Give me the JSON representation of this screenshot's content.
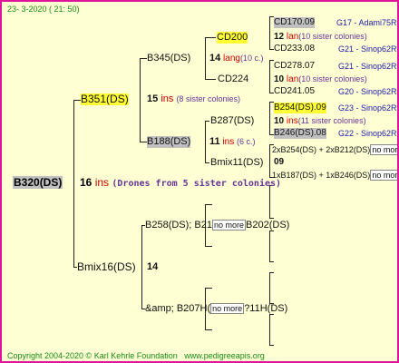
{
  "header": {
    "date": "23- 3-2020 ( 21: 50)"
  },
  "root": {
    "name": "B320(DS)"
  },
  "root_info": {
    "count": "16",
    "unit": "ins",
    "note": "(Drones from 5 sister colonies)"
  },
  "gen1": {
    "father": {
      "name": "B351(DS)",
      "count": "15",
      "unit": "ins",
      "note": "(8 sister colonies)"
    },
    "mother": {
      "name": "Bmix16(DS)",
      "count": "14"
    }
  },
  "gen2": {
    "b345": {
      "name": "B345(DS)",
      "count": "14",
      "unit": "lang",
      "note": "(10 c.)"
    },
    "b188": {
      "name": "B188(DS)",
      "count": "11",
      "unit": "ins",
      "note": "(6 c.)"
    },
    "b258": {
      "name": "B258(DS); B21",
      "nomore": "no more",
      "tail": "B202(DS)"
    },
    "b207": {
      "name": "&amp; B207H(",
      "nomore": "no more",
      "tail": "?11H(DS)"
    }
  },
  "gen3": {
    "cd200": {
      "name": "CD200"
    },
    "cd224": {
      "name": "CD224"
    },
    "b287": {
      "name": "B287(DS)"
    },
    "bmix11": {
      "name": "Bmix11(DS)"
    }
  },
  "gen4": [
    {
      "name": "CD170.09",
      "meta": "G17 - Adami75R",
      "count": "12",
      "unit": "lan",
      "note": "(10 sister colonies)",
      "hl": ""
    },
    {
      "name": "CD233.08",
      "meta": "G21 - Sinop62R",
      "count": "",
      "unit": "",
      "note": "",
      "hl": ""
    },
    {
      "name": "CD278.07",
      "meta": "G21 - Sinop62R",
      "count": "10",
      "unit": "lan",
      "note": "(10 sister colonies)",
      "hl": ""
    },
    {
      "name": "CD241.05",
      "meta": "G20 - Sinop62R",
      "count": "",
      "unit": "",
      "note": "",
      "hl": ""
    },
    {
      "name": "B254(DS).09",
      "meta": "G23 - Sinop62R",
      "count": "10",
      "unit": "ins",
      "note": "(11 sister colonies)",
      "hl": "y"
    },
    {
      "name": "B246(DS).08",
      "meta": "G22 - Sinop62R",
      "count": "",
      "unit": "",
      "note": "",
      "hl": "g"
    }
  ],
  "bmix11_children": {
    "first": "2xB254(DS) + 2xB212(DS)",
    "first_nomore": "no more",
    "count": "09",
    "second": "1xB187(DS) + 1xB246(DS)",
    "second_nomore": "no more"
  },
  "footer": {
    "copyright": "Copyright 2004-2020 © Karl Kehrle Foundation",
    "site": "www.pedigreeapis.org"
  }
}
